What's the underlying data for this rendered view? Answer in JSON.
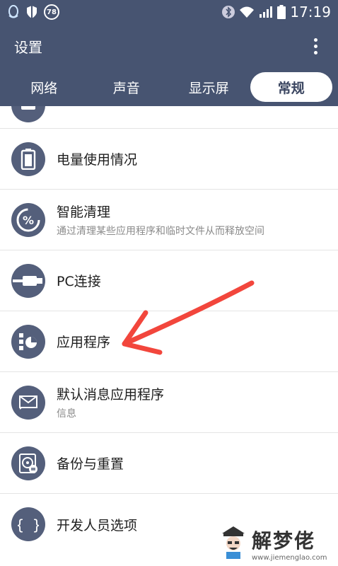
{
  "status": {
    "time": "17:19",
    "badge": "78"
  },
  "app_bar": {
    "title": "设置"
  },
  "tabs": [
    {
      "label": "网络"
    },
    {
      "label": "声音"
    },
    {
      "label": "显示屏"
    },
    {
      "label": "常规"
    }
  ],
  "list": {
    "items": [
      {
        "title": "电量使用情况",
        "subtitle": ""
      },
      {
        "title": "智能清理",
        "subtitle": "通过清理某些应用程序和临时文件从而释放空间"
      },
      {
        "title": "PC连接",
        "subtitle": ""
      },
      {
        "title": "应用程序",
        "subtitle": ""
      },
      {
        "title": "默认消息应用程序",
        "subtitle": "信息"
      },
      {
        "title": "备份与重置",
        "subtitle": ""
      },
      {
        "title": "开发人员选项",
        "subtitle": ""
      }
    ]
  },
  "icons": {
    "battery": "battery-icon",
    "clean": "percent-cleanup-icon",
    "pc": "usb-cable-icon",
    "apps": "apps-grid-icon",
    "message": "message-envelope-icon",
    "backup": "backup-disk-icon",
    "developer": "braces-icon"
  },
  "colors": {
    "header": "#475471",
    "icon_bg": "#545f7b",
    "annotation_arrow": "#f2463c"
  },
  "watermark": {
    "name": "解梦佬",
    "url": "www.jiemenglao.com"
  }
}
